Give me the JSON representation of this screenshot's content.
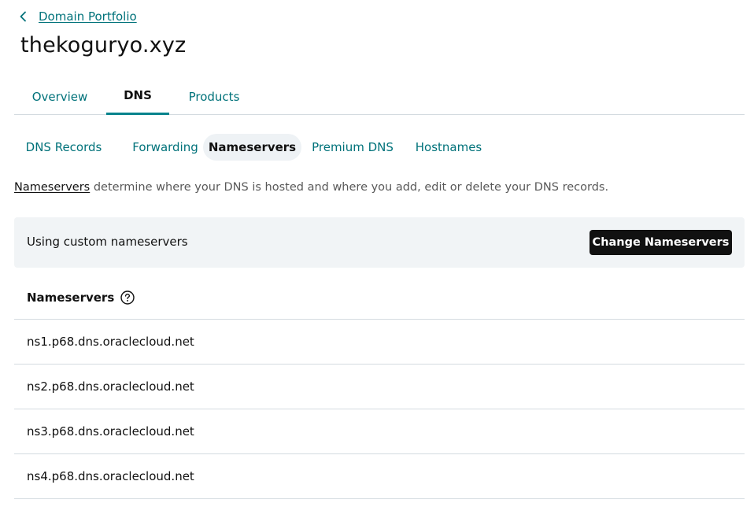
{
  "breadcrumb": {
    "icon": "chevron-left-icon",
    "label": "Domain Portfolio"
  },
  "domain": {
    "title": "thekoguryo.xyz"
  },
  "primary_tabs": [
    {
      "label": "Overview",
      "active": false
    },
    {
      "label": "DNS",
      "active": true
    },
    {
      "label": "Products",
      "active": false
    }
  ],
  "secondary_tabs": [
    {
      "label": "DNS Records",
      "active": false
    },
    {
      "label": "Forwarding",
      "active": false
    },
    {
      "label": "Nameservers",
      "active": true
    },
    {
      "label": "Premium DNS",
      "active": false
    },
    {
      "label": "Hostnames",
      "active": false
    }
  ],
  "description": {
    "link_text": "Nameservers",
    "text": " determine where your DNS is hosted and where you add, edit or delete your DNS records."
  },
  "banner": {
    "status_text": "Using custom nameservers",
    "button_label": "Change Nameservers"
  },
  "nameservers": {
    "header": "Nameservers",
    "help_icon": "question-circle-icon",
    "items": [
      "ns1.p68.dns.oraclecloud.net",
      "ns2.p68.dns.oraclecloud.net",
      "ns3.p68.dns.oraclecloud.net",
      "ns4.p68.dns.oraclecloud.net"
    ]
  },
  "colors": {
    "link_teal": "#00727a",
    "active_underline": "#00838c",
    "banner_bg": "#f1f4f6",
    "button_bg": "#111111",
    "divider": "#d4dbe0"
  }
}
